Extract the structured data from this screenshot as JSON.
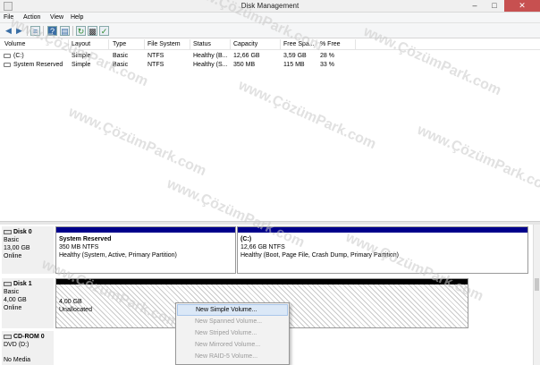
{
  "window": {
    "title": "Disk Management"
  },
  "menu": [
    "File",
    "Action",
    "View",
    "Help"
  ],
  "toolbar": [
    "back-arrow-icon",
    "forward-arrow-icon",
    "list-view-icon",
    "help-icon",
    "properties-icon",
    "refresh-icon",
    "check-icon"
  ],
  "volume_list": {
    "columns": [
      "Volume",
      "Layout",
      "Type",
      "File System",
      "Status",
      "Capacity",
      "Free Spa...",
      "% Free"
    ],
    "rows": [
      [
        "(C:)",
        "Simple",
        "Basic",
        "NTFS",
        "Healthy (B...",
        "12,66 GB",
        "3,59 GB",
        "28 %"
      ],
      [
        "System Reserved",
        "Simple",
        "Basic",
        "NTFS",
        "Healthy (S...",
        "350 MB",
        "115 MB",
        "33 %"
      ]
    ]
  },
  "disks": {
    "disk0": {
      "name": "Disk 0",
      "type": "Basic",
      "size": "13,00 GB",
      "status": "Online",
      "partitions": [
        {
          "name": "System Reserved",
          "size": "350 MB NTFS",
          "status": "Healthy (System, Active, Primary Partition)"
        },
        {
          "name": "(C:)",
          "size": "12,66 GB NTFS",
          "status": "Healthy (Boot, Page File, Crash Dump, Primary Partition)"
        }
      ]
    },
    "disk1": {
      "name": "Disk 1",
      "type": "Basic",
      "size": "4,00 GB",
      "status": "Online",
      "unallocated": {
        "size": "4,00 GB",
        "label": "Unallocated"
      }
    },
    "cdrom0": {
      "name": "CD-ROM 0",
      "type": "DVD (D:)",
      "status": "No Media"
    }
  },
  "context_menu": {
    "items": [
      {
        "label": "New Simple Volume...",
        "state": "highlighted"
      },
      {
        "label": "New Spanned Volume...",
        "state": "disabled"
      },
      {
        "label": "New Striped Volume...",
        "state": "disabled"
      },
      {
        "label": "New Mirrored Volume...",
        "state": "disabled"
      },
      {
        "label": "New RAID-5 Volume...",
        "state": "disabled"
      }
    ]
  },
  "watermark": {
    "text": "www.ÇözümPark.com"
  },
  "colors": {
    "primary_band": "#00008b",
    "unallocated_band": "#000000",
    "close_button": "#c75050"
  }
}
